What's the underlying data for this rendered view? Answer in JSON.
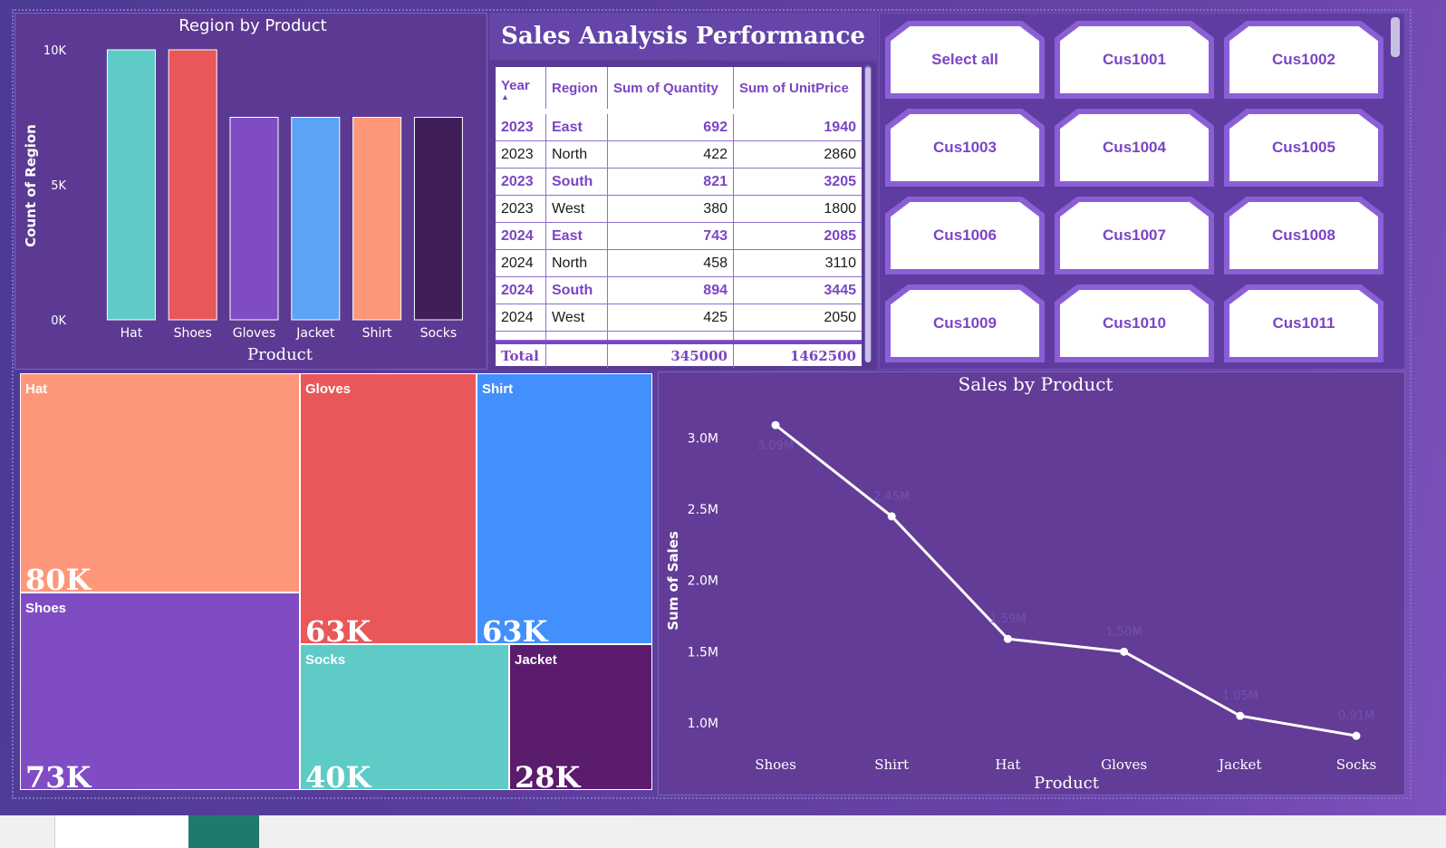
{
  "report": {
    "title": "Sales Analysis Performance"
  },
  "colors": {
    "hat": "#5ecbc7",
    "shoes": "#e95758",
    "gloves": "#7f4cc4",
    "jacket": "#5da3f6",
    "shirt": "#fe977a",
    "socks": "#3f1e59"
  },
  "region_chart": {
    "chart_data": {
      "type": "bar",
      "title": "Region by Product",
      "xlabel": "Product",
      "ylabel": "Count of Region",
      "categories": [
        "Hat",
        "Shoes",
        "Gloves",
        "Jacket",
        "Shirt",
        "Socks"
      ],
      "values": [
        10000,
        10000,
        7500,
        7500,
        7500,
        7500
      ],
      "ylim": [
        0,
        10000
      ],
      "yticks": [
        "0K",
        "5K",
        "10K"
      ],
      "colors": [
        "#5ecbc7",
        "#e95758",
        "#7f4cc4",
        "#5da3f6",
        "#fe977a",
        "#3f1e59"
      ]
    }
  },
  "table": {
    "headers": [
      "Year",
      "Region",
      "Sum of Quantity",
      "Sum of UnitPrice"
    ],
    "rows": [
      [
        "2023",
        "East",
        "692",
        "1940"
      ],
      [
        "2023",
        "North",
        "422",
        "2860"
      ],
      [
        "2023",
        "South",
        "821",
        "3205"
      ],
      [
        "2023",
        "West",
        "380",
        "1800"
      ],
      [
        "2024",
        "East",
        "743",
        "2085"
      ],
      [
        "2024",
        "North",
        "458",
        "3110"
      ],
      [
        "2024",
        "South",
        "894",
        "3445"
      ],
      [
        "2024",
        "West",
        "425",
        "2050"
      ]
    ],
    "total": [
      "Total",
      "",
      "345000",
      "1462500"
    ]
  },
  "slicer": {
    "items": [
      "Select all",
      "Cus1001",
      "Cus1002",
      "Cus1003",
      "Cus1004",
      "Cus1005",
      "Cus1006",
      "Cus1007",
      "Cus1008",
      "Cus1009",
      "Cus1010",
      "Cus1011"
    ]
  },
  "treemap": {
    "chart_data": {
      "type": "treemap",
      "items": [
        {
          "name": "Hat",
          "value": "80K",
          "color": "#fe977a"
        },
        {
          "name": "Shoes",
          "value": "73K",
          "color": "#7f4cc4"
        },
        {
          "name": "Gloves",
          "value": "63K",
          "color": "#e95758"
        },
        {
          "name": "Shirt",
          "value": "63K",
          "color": "#438ffb"
        },
        {
          "name": "Socks",
          "value": "40K",
          "color": "#5ecbc7"
        },
        {
          "name": "Jacket",
          "value": "28K",
          "color": "#5b1c6d"
        }
      ]
    }
  },
  "line_chart": {
    "chart_data": {
      "type": "line",
      "title": "Sales by Product",
      "xlabel": "Product",
      "ylabel": "Sum of Sales",
      "categories": [
        "Shoes",
        "Shirt",
        "Hat",
        "Gloves",
        "Jacket",
        "Socks"
      ],
      "values": [
        3.09,
        2.45,
        1.59,
        1.5,
        1.05,
        0.91
      ],
      "data_labels": [
        "3.09M",
        "2.45M",
        "1.59M",
        "1.50M",
        "1.05M",
        "0.91M"
      ],
      "yticks": [
        "1.0M",
        "1.5M",
        "2.0M",
        "2.5M",
        "3.0M"
      ],
      "ylim": [
        1.0,
        3.0
      ]
    }
  }
}
